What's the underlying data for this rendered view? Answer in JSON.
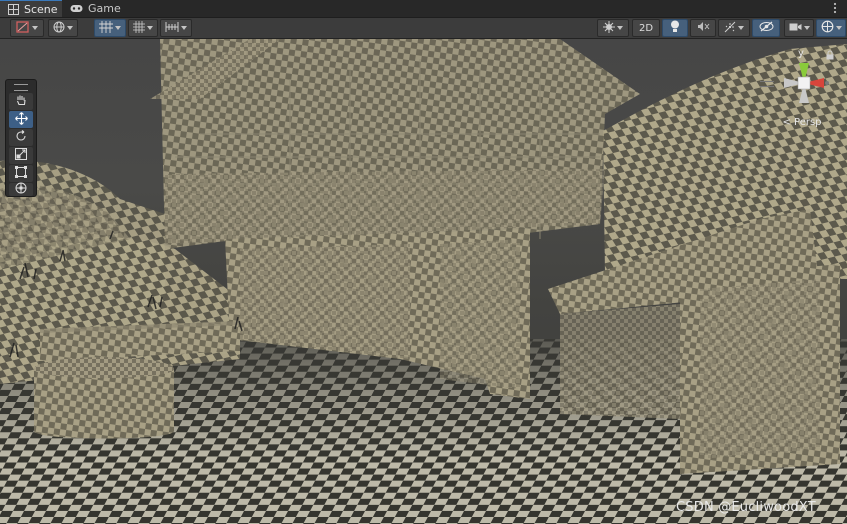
{
  "tabs": [
    {
      "label": "Scene",
      "icon": "scene-grid-icon",
      "active": true
    },
    {
      "label": "Game",
      "icon": "gamepad-icon",
      "active": false
    }
  ],
  "toolbar": {
    "view_2d_label": "2D",
    "left_tools": [
      "draw-mode-icon",
      "global-icon",
      "grid-snap-icon",
      "grid-visibility-icon",
      "increment-snap-icon"
    ],
    "right_tools": [
      "gizmos-icon",
      "2d-toggle",
      "lighting-icon",
      "audio-icon",
      "effects-icon",
      "hidden-visibility-icon",
      "camera-icon",
      "transform-gizmo-icon"
    ]
  },
  "tool_palette": [
    "hand-tool-icon",
    "move-tool-icon",
    "rotate-tool-icon",
    "scale-tool-icon",
    "rect-tool-icon",
    "transform-tool-icon"
  ],
  "active_tool": "move-tool-icon",
  "gizmo": {
    "axis_y_label": "y",
    "projection_label": "< Persp",
    "colors": {
      "x": "#d8453b",
      "y": "#8acb3a",
      "z": "#3b7bd8"
    }
  },
  "watermark": "CSDN @EucliwoodXT",
  "colors": {
    "tab_active_accent": "#3a79bb",
    "toolbar_toggle_on": "#46607c",
    "checker": "#b3aa8c"
  }
}
